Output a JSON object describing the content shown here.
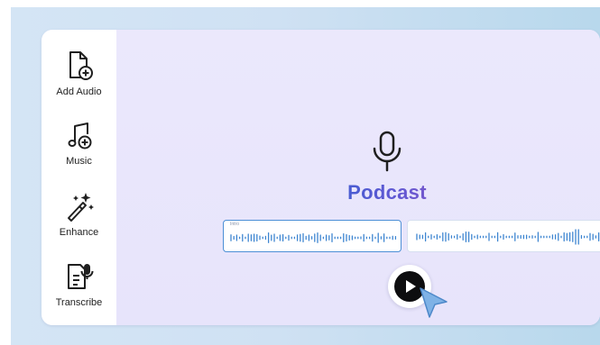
{
  "sidebar": {
    "items": [
      {
        "label": "Add Audio",
        "icon": "add-audio-icon"
      },
      {
        "label": "Music",
        "icon": "music-add-icon"
      },
      {
        "label": "Enhance",
        "icon": "magic-wand-icon"
      },
      {
        "label": "Transcribe",
        "icon": "transcribe-icon"
      }
    ]
  },
  "main": {
    "title": "Podcast",
    "title_icon": "microphone-icon",
    "clips": [
      {
        "tag": "Intro",
        "selected": true
      },
      {
        "tag": "",
        "selected": false
      }
    ],
    "play_icon": "play-icon",
    "pointer_icon": "cursor-pointer-icon"
  },
  "colors": {
    "accent": "#4c8fd6",
    "title_gradient_start": "#3a5fd1",
    "title_gradient_end": "#8757c8",
    "cursor": "#7fb2e6",
    "canvas": "#e9e6fb"
  }
}
